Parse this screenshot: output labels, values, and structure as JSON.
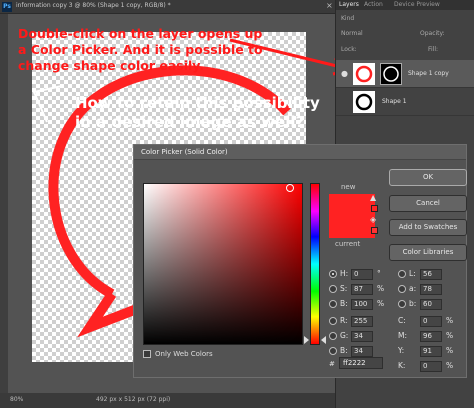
{
  "document": {
    "title": "information copy 3 @ 80% (Shape 1 copy, RGB/8) *",
    "ps_badge": "Ps",
    "zoom": "80%",
    "size": "492 px x 512 px (72 ppi)"
  },
  "annotations": {
    "red_note": "Double-click on the layer opens up a Color Picker. And it is possible to change shape color easily.",
    "white_note": "How to retain this possibility in a desired image as well?",
    "accent_color": "#ff2222"
  },
  "layers_panel": {
    "tabs": [
      "Layers",
      "Action",
      "Device Preview"
    ],
    "kind_label": "Kind",
    "blend_mode": "Normal",
    "opacity_label": "Opacity:",
    "lock_label": "Lock:",
    "fill_label": "Fill:",
    "layers": [
      {
        "name": "Shape 1 copy",
        "selected": true
      },
      {
        "name": "Shape 1",
        "selected": false
      }
    ]
  },
  "color_picker": {
    "title": "Color Picker (Solid Color)",
    "new_label": "new",
    "current_label": "current",
    "buttons": {
      "ok": "OK",
      "cancel": "Cancel",
      "add_to_swatches": "Add to Swatches",
      "color_libraries": "Color Libraries"
    },
    "fields": {
      "H": {
        "value": "0",
        "unit": "°"
      },
      "S": {
        "value": "87",
        "unit": "%"
      },
      "B": {
        "value": "100",
        "unit": "%"
      },
      "R": {
        "value": "255"
      },
      "G": {
        "value": "34"
      },
      "Bl": {
        "value": "34"
      },
      "L": {
        "value": "56"
      },
      "a": {
        "value": "78"
      },
      "b": {
        "value": "60"
      },
      "C": {
        "value": "0",
        "unit": "%"
      },
      "M": {
        "value": "96",
        "unit": "%"
      },
      "Y": {
        "value": "91",
        "unit": "%"
      },
      "K": {
        "value": "0",
        "unit": "%"
      }
    },
    "labels": {
      "H": "H:",
      "S": "S:",
      "B": "B:",
      "R": "R:",
      "G": "G:",
      "Bl": "B:",
      "L": "L:",
      "a": "a:",
      "b": "b:",
      "C": "C:",
      "M": "M:",
      "Y": "Y:",
      "K": "K:"
    },
    "only_web_colors": "Only Web Colors",
    "hex_hash": "#",
    "hex": "ff2222",
    "selected_color": "#ff2222"
  }
}
